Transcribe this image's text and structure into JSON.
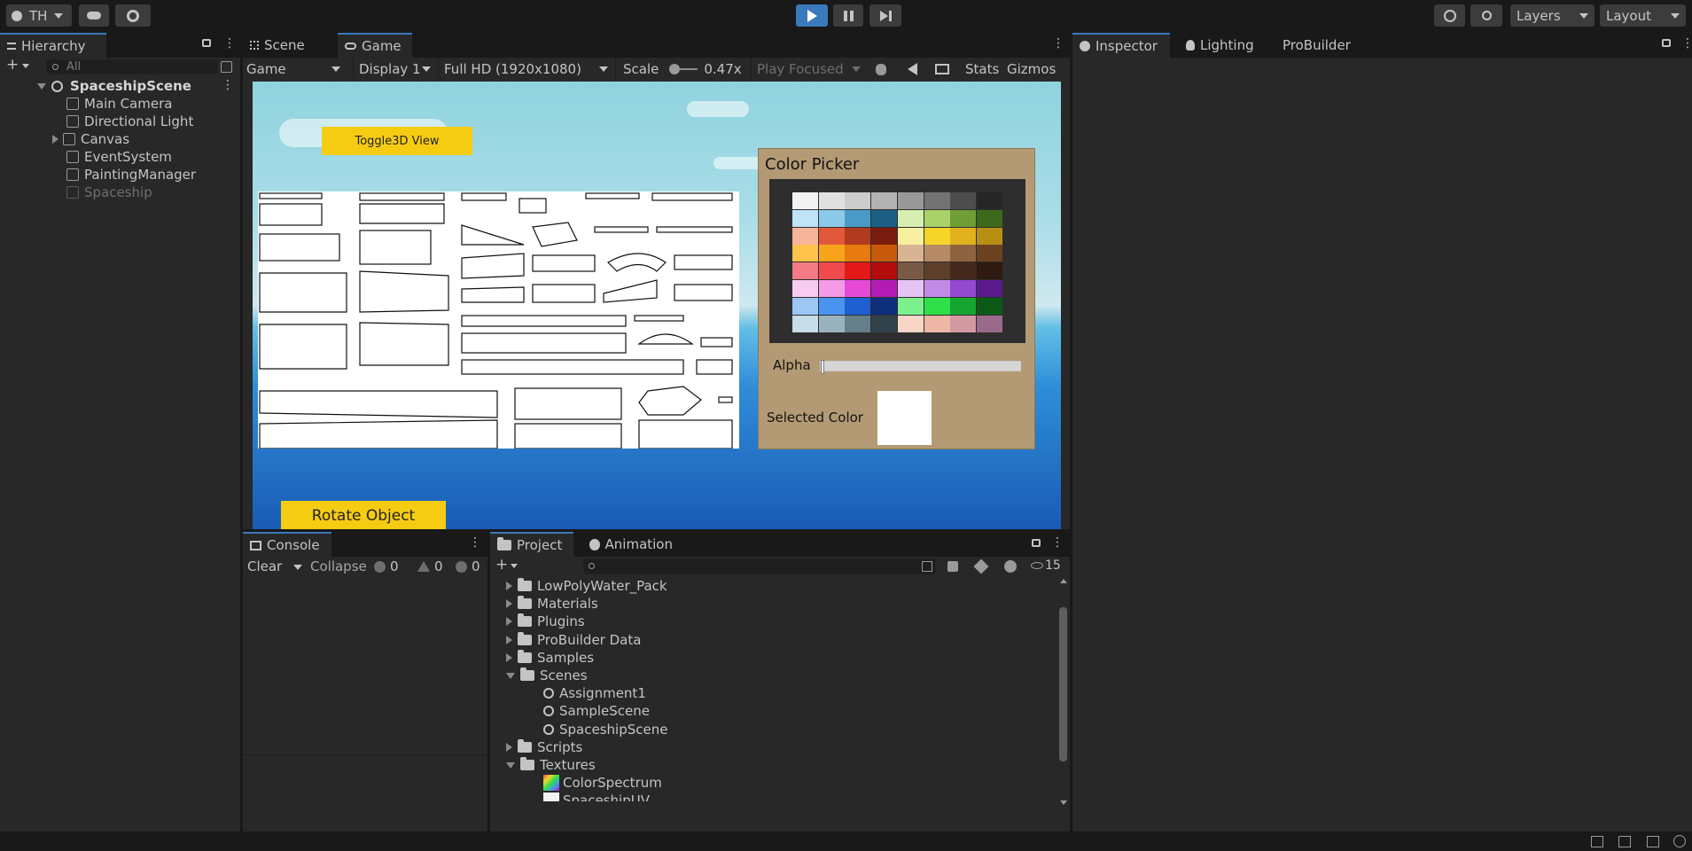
{
  "topbar": {
    "account": "TH",
    "layers": "Layers",
    "layout": "Layout"
  },
  "hierarchy": {
    "title": "Hierarchy",
    "search_placeholder": "All",
    "scene": "SpaceshipScene",
    "items": [
      "Main Camera",
      "Directional Light",
      "Canvas",
      "EventSystem",
      "PaintingManager",
      "Spaceship"
    ]
  },
  "view_tabs": {
    "scene": "Scene",
    "game": "Game"
  },
  "game_toolbar": {
    "mode": "Game",
    "display": "Display 1",
    "resolution": "Full HD (1920x1080)",
    "scale_label": "Scale",
    "scale_value": "0.47x",
    "scale_fraction": 0.05,
    "play_focused": "Play Focused",
    "stats": "Stats",
    "gizmos": "Gizmos"
  },
  "game_view": {
    "toggle_button": "Toggle3D View",
    "rotate_button": "Rotate Object",
    "color_picker": {
      "title": "Color Picker",
      "alpha_label": "Alpha",
      "alpha_fraction": 0.0,
      "selected_label": "Selected Color",
      "selected_color": "#ffffff",
      "palette": [
        [
          "#f2f2f2",
          "#e0e0e0",
          "#cccccc",
          "#b3b3b3",
          "#999999",
          "#737373",
          "#4d4d4d",
          "#262626"
        ],
        [
          "#bfe4f7",
          "#8cc8e8",
          "#4a9ac8",
          "#1e5f86",
          "#d6efb0",
          "#a9d26a",
          "#6e9e35",
          "#3d6a1a"
        ],
        [
          "#f7b59b",
          "#e2583a",
          "#b03b1f",
          "#7a1c10",
          "#f7f0a0",
          "#f5d52a",
          "#e1b21d",
          "#b68f13"
        ],
        [
          "#ffc24a",
          "#f8a41a",
          "#e77a10",
          "#c75a0a",
          "#d9b493",
          "#b58a64",
          "#8e6340",
          "#6a4220"
        ],
        [
          "#f47a85",
          "#f04a4d",
          "#e31919",
          "#b20c0c",
          "#7a5a46",
          "#5e3f2c",
          "#45291d",
          "#2e1a10"
        ],
        [
          "#f8cbf0",
          "#f49ae6",
          "#e54ad6",
          "#b21cb4",
          "#e6c3f5",
          "#c18ae6",
          "#9548d0",
          "#5a1a8e"
        ],
        [
          "#9cc7f5",
          "#4a94ef",
          "#1f5fd1",
          "#0e2f7a",
          "#7cf08a",
          "#2fe04a",
          "#14a62e",
          "#0b5a18"
        ],
        [
          "#c7dde8",
          "#9ab2be",
          "#667f8b",
          "#33434c",
          "#f8d6c7",
          "#f0b6a6",
          "#d39aa3",
          "#9a6a8a"
        ]
      ]
    }
  },
  "console": {
    "title": "Console",
    "clear": "Clear",
    "collapse": "Collapse",
    "info_count": "0",
    "warn_count": "0",
    "error_count": "0"
  },
  "project": {
    "title": "Project",
    "animation": "Animation",
    "hidden_count": "15",
    "tree": [
      {
        "label": "LowPolyWater_Pack",
        "type": "folder",
        "expanded": false,
        "depth": 0
      },
      {
        "label": "Materials",
        "type": "folder",
        "expanded": false,
        "depth": 0
      },
      {
        "label": "Plugins",
        "type": "folder",
        "expanded": false,
        "depth": 0
      },
      {
        "label": "ProBuilder Data",
        "type": "folder",
        "expanded": false,
        "depth": 0
      },
      {
        "label": "Samples",
        "type": "folder",
        "expanded": false,
        "depth": 0
      },
      {
        "label": "Scenes",
        "type": "folder",
        "expanded": true,
        "depth": 0
      },
      {
        "label": "Assignment1",
        "type": "scene",
        "depth": 1
      },
      {
        "label": "SampleScene",
        "type": "scene",
        "depth": 1
      },
      {
        "label": "SpaceshipScene",
        "type": "scene",
        "depth": 1
      },
      {
        "label": "Scripts",
        "type": "folder",
        "expanded": false,
        "depth": 0
      },
      {
        "label": "Textures",
        "type": "folder",
        "expanded": true,
        "depth": 0
      },
      {
        "label": "ColorSpectrum",
        "type": "texture",
        "depth": 1
      },
      {
        "label": "SpaceshipUV",
        "type": "texture",
        "depth": 1
      }
    ]
  },
  "inspector_tabs": {
    "inspector": "Inspector",
    "lighting": "Lighting",
    "probuilder": "ProBuilder"
  }
}
